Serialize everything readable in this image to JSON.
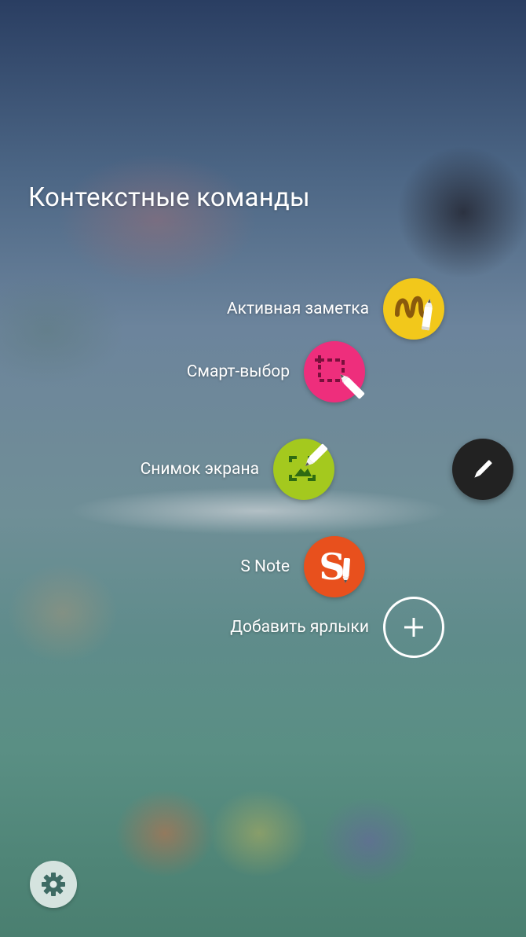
{
  "title": "Контекстные команды",
  "items": [
    {
      "label": "Активная заметка",
      "icon": "live-message-icon",
      "color": "#f2c81b"
    },
    {
      "label": "Смарт-выбор",
      "icon": "smart-select-icon",
      "color": "#ee2e7c"
    },
    {
      "label": "Снимок экрана",
      "icon": "screen-write-icon",
      "color": "#a4c91e"
    },
    {
      "label": "S Note",
      "icon": "s-note-icon",
      "color": "#e8501d"
    },
    {
      "label": "Добавить ярлыки",
      "icon": "plus-icon",
      "color": "#ffffff"
    }
  ],
  "pen_button": {
    "icon": "pen-icon",
    "color": "#222222"
  },
  "settings_button": {
    "icon": "gear-icon"
  }
}
